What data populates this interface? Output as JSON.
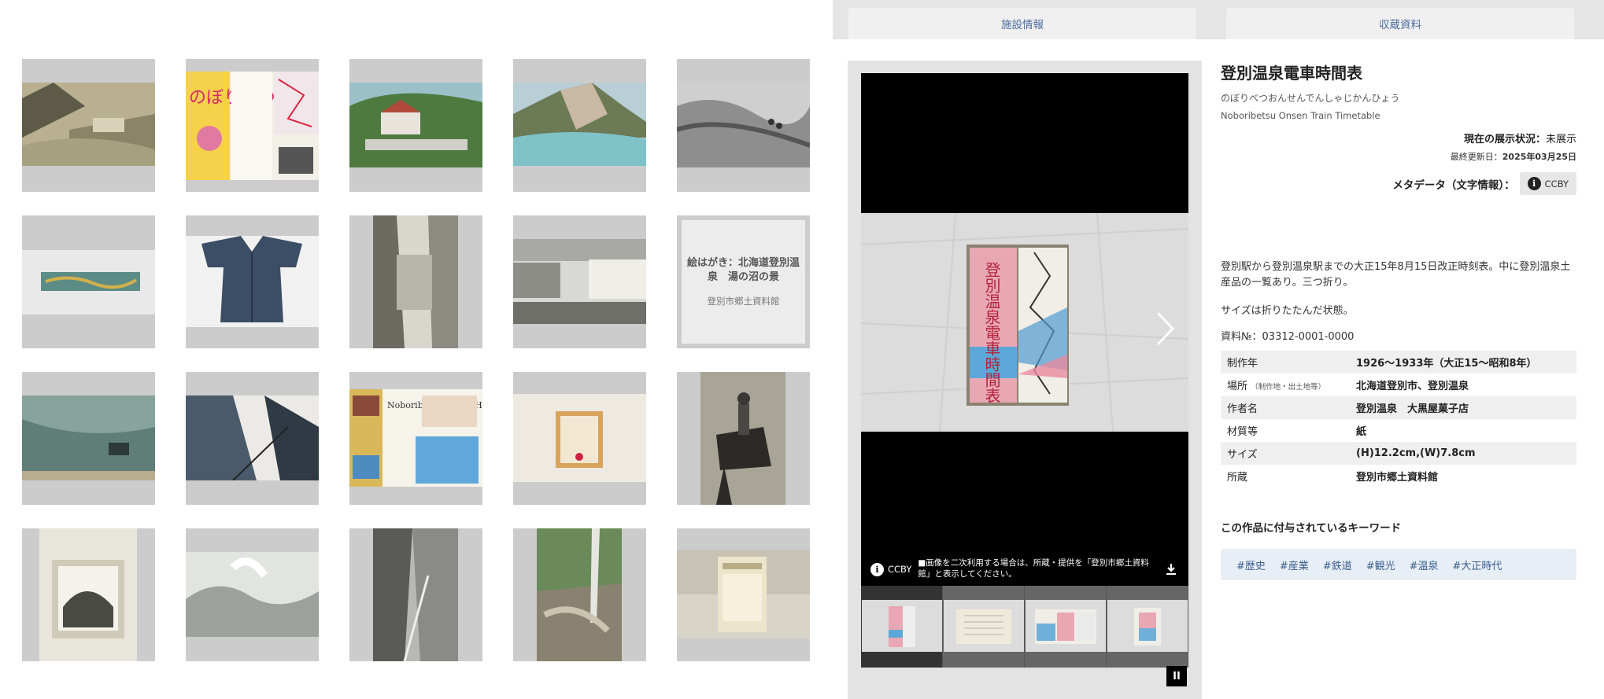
{
  "tabs": [
    {
      "label": "施設情報"
    },
    {
      "label": "収蔵資料"
    }
  ],
  "gallery": {
    "text_card": {
      "title": "絵はがき：北海道登別温泉　湯の沼の景",
      "subtitle": "登別市郷土資料館"
    },
    "leaflet_text": "のぼりべつ",
    "hotel_leaflet_text": "Noboribetsu Grand Hotel"
  },
  "viewer": {
    "license": "CCBY",
    "notice": "■画像を二次利用する場合は、所蔵・提供を「登別市郷土資料館」と表示してください。",
    "pause_label": "II"
  },
  "detail": {
    "title": "登別温泉電車時間表",
    "kana": "のぼりべつおんせんでんしゃじかんひょう",
    "english": "Noboribetsu Onsen Train Timetable",
    "status_label": "現在の展示状況：",
    "status_value": "未展示",
    "updated_label": "最終更新日：",
    "updated_value": "2025年03月25日",
    "metadata_label": "メタデータ（文字情報）：",
    "license": "CCBY",
    "description": "登別駅から登別温泉駅までの大正15年8月15日改正時刻表。中に登別温泉土産品の一覧あり。三つ折り。",
    "size_note": "サイズは折りたたんだ状態。",
    "id_text": "資料№：03312-0001-0000",
    "table": [
      {
        "key": "制作年",
        "value": "1926〜1933年（大正15〜昭和8年）"
      },
      {
        "key": "場所",
        "key_small": "（制作地・出土地等）",
        "value": "北海道登別市、登別温泉"
      },
      {
        "key": "作者名",
        "value": "登別温泉　大黒屋菓子店"
      },
      {
        "key": "材質等",
        "value": "紙"
      },
      {
        "key": "サイズ",
        "value": "(H)12.2cm,(W)7.8cm"
      },
      {
        "key": "所蔵",
        "value": "登別市郷土資料館"
      }
    ],
    "keywords_title": "この作品に付与されているキーワード",
    "keywords": [
      "#歴史",
      "#産業",
      "#鉄道",
      "#観光",
      "#温泉",
      "#大正時代"
    ]
  },
  "cover_text": "登別温泉電車時間表",
  "colors": {
    "tile_bg": "#cccccc",
    "tab_text": "#4a6b9c",
    "keyword_bg": "#e7eef6",
    "viewer_bg": "#000000"
  }
}
